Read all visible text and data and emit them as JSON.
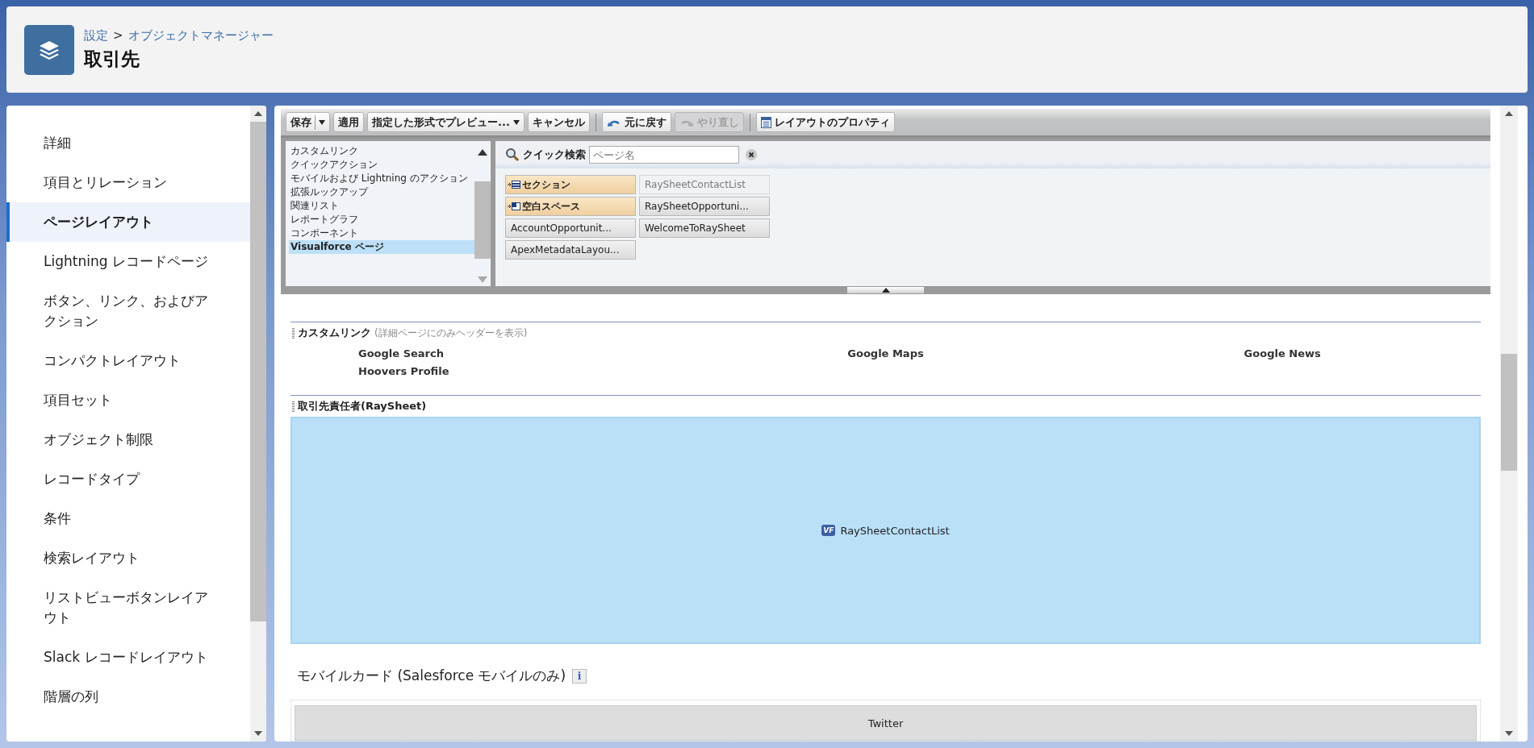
{
  "header": {
    "breadcrumb": {
      "parent": "設定",
      "separator": ">",
      "current": "オブジェクトマネージャー"
    },
    "title": "取引先"
  },
  "sidebar": {
    "items": [
      {
        "label": "詳細",
        "selected": false
      },
      {
        "label": "項目とリレーション",
        "selected": false
      },
      {
        "label": "ページレイアウト",
        "selected": true
      },
      {
        "label": "Lightning レコードページ",
        "selected": false
      },
      {
        "label": "ボタン、リンク、およびアクション",
        "selected": false
      },
      {
        "label": "コンパクトレイアウト",
        "selected": false
      },
      {
        "label": "項目セット",
        "selected": false
      },
      {
        "label": "オブジェクト制限",
        "selected": false
      },
      {
        "label": "レコードタイプ",
        "selected": false
      },
      {
        "label": "条件",
        "selected": false
      },
      {
        "label": "検索レイアウト",
        "selected": false
      },
      {
        "label": "リストビューボタンレイアウト",
        "selected": false
      },
      {
        "label": "Slack レコードレイアウト",
        "selected": false
      },
      {
        "label": "階層の列",
        "selected": false
      }
    ]
  },
  "toolbar": {
    "groups": [
      [
        {
          "label": "保存",
          "kind": "split",
          "disabled": false
        },
        {
          "label": "適用",
          "kind": "plain",
          "disabled": false
        },
        {
          "label": "指定した形式でプレビュー...",
          "kind": "dropdown",
          "disabled": false
        },
        {
          "label": "キャンセル",
          "kind": "plain",
          "disabled": false
        }
      ],
      [
        {
          "label": "元に戻す",
          "kind": "undo",
          "disabled": false
        },
        {
          "label": "やり直し",
          "kind": "redo",
          "disabled": true
        }
      ],
      [
        {
          "label": "レイアウトのプロパティ",
          "kind": "properties",
          "disabled": false
        }
      ]
    ]
  },
  "palette": {
    "categories": [
      {
        "label": "カスタムリンク",
        "selected": false
      },
      {
        "label": "クイックアクション",
        "selected": false
      },
      {
        "label": "モバイルおよび Lightning のアクション",
        "selected": false
      },
      {
        "label": "拡張ルックアップ",
        "selected": false
      },
      {
        "label": "関連リスト",
        "selected": false
      },
      {
        "label": "レポートグラフ",
        "selected": false
      },
      {
        "label": "コンポーネント",
        "selected": false
      },
      {
        "label": "Visualforce ページ",
        "selected": true
      }
    ],
    "quick_search": {
      "label": "クイック検索",
      "placeholder": "ページ名"
    },
    "items": [
      {
        "label": "セクション",
        "kind": "section",
        "disabled": false
      },
      {
        "label": "RaySheetContactList",
        "kind": "page",
        "disabled": true
      },
      {
        "label": "空白スペース",
        "kind": "blank",
        "disabled": false
      },
      {
        "label": "RaySheetOpportuni...",
        "kind": "page",
        "disabled": false
      },
      {
        "label": "AccountOpportunit...",
        "kind": "page",
        "disabled": false
      },
      {
        "label": "WelcomeToRaySheet",
        "kind": "page",
        "disabled": false
      },
      {
        "label": "ApexMetadataLayou...",
        "kind": "page",
        "disabled": false
      }
    ]
  },
  "custom_links": {
    "title": "カスタムリンク",
    "note": "(詳細ページにのみヘッダーを表示)",
    "links": [
      "Google Search",
      "Google Maps",
      "Google News",
      "Hoovers Profile"
    ]
  },
  "visualforce_section": {
    "title": "取引先責任者(RaySheet)",
    "icon_text": "VF",
    "page": "RaySheetContactList"
  },
  "mobile_cards": {
    "title": "モバイルカード (Salesforce モバイルのみ)",
    "info": "i",
    "items": [
      "Twitter"
    ]
  }
}
